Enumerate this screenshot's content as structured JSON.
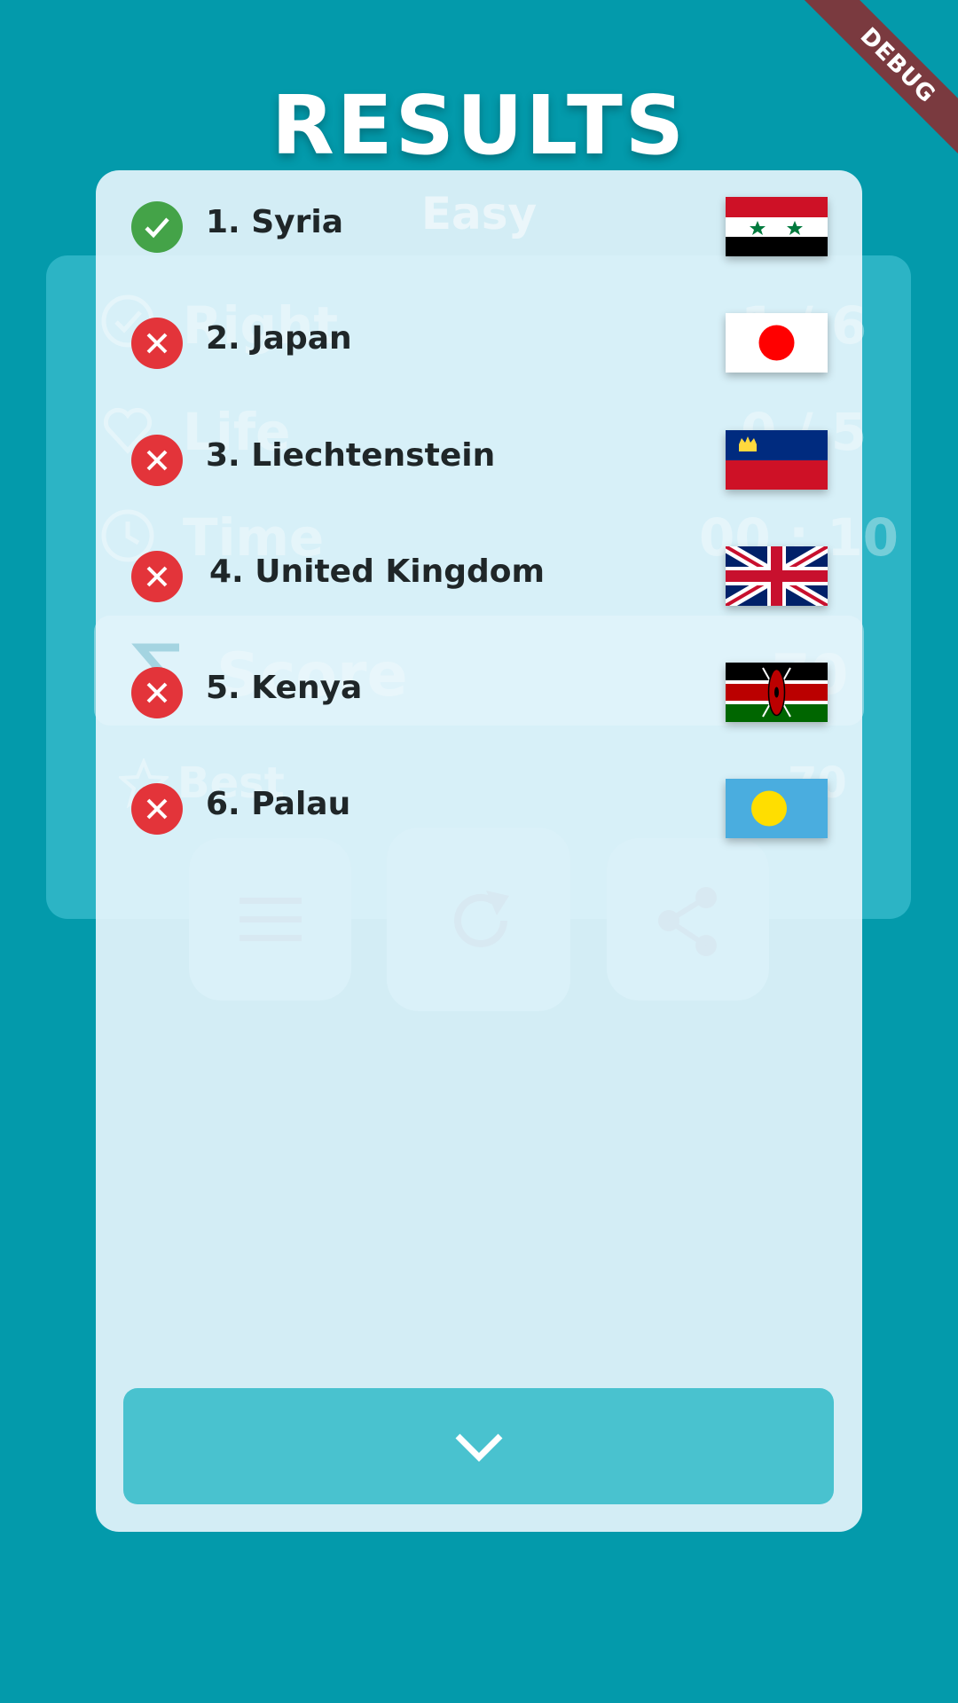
{
  "screen_title": "RESULTS",
  "debug_label": "DEBUG",
  "background_stats": {
    "difficulty": "Easy",
    "rows": [
      {
        "label": "Right",
        "value": "1 / 6"
      },
      {
        "label": "Life",
        "value": "0 / 5"
      },
      {
        "label": "Time",
        "value": "00 : 10"
      },
      {
        "label": "Score",
        "value": "70"
      },
      {
        "label": "Best",
        "value": "70"
      }
    ]
  },
  "results": [
    {
      "label": "1. Syria",
      "correct": true,
      "flag": "syria-flag"
    },
    {
      "label": "2. Japan",
      "correct": false,
      "flag": "japan-flag"
    },
    {
      "label": "3. Liechtenstein",
      "correct": false,
      "flag": "liechtenstein-flag"
    },
    {
      "label": "4. United Kingdom",
      "correct": false,
      "flag": "united-kingdom-flag"
    },
    {
      "label": "5. Kenya",
      "correct": false,
      "flag": "kenya-flag"
    },
    {
      "label": "6. Palau",
      "correct": false,
      "flag": "palau-flag"
    }
  ],
  "colors": {
    "background": "#039aab",
    "panel": "#eaf6fd",
    "correct": "#44a348",
    "wrong": "#e3343a",
    "collapse_button": "#49c2cf"
  },
  "icons": {
    "collapse": "chevron-down-icon",
    "correct": "check-icon",
    "wrong": "close-icon",
    "menu": "menu-icon",
    "restart": "restart-icon",
    "share": "share-icon"
  }
}
